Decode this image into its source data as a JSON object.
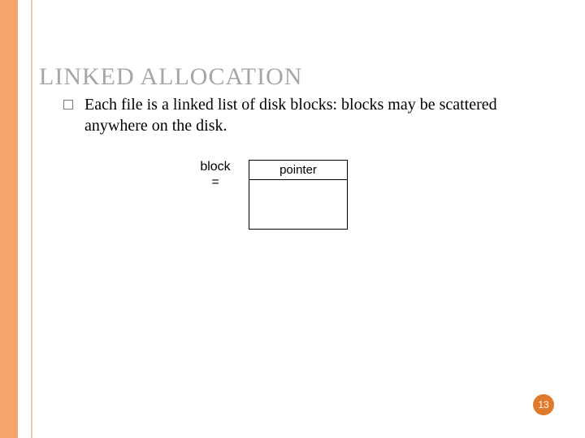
{
  "title": "LINKED ALLOCATION",
  "bullet": "Each file is a linked list of disk blocks: blocks may be scattered anywhere on the disk.",
  "diagram": {
    "label_line1": "block",
    "label_line2": "=",
    "pointer": "pointer"
  },
  "page_number": "13"
}
